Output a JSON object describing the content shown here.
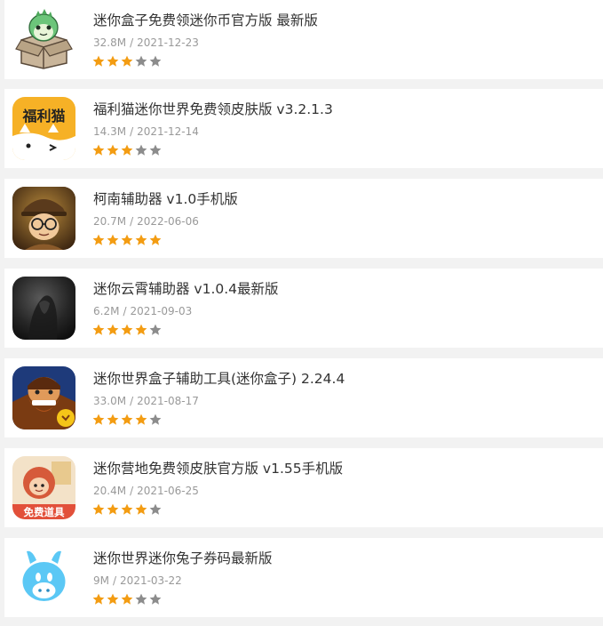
{
  "colors": {
    "page_background": "#f2f2f2",
    "card_background": "#ffffff",
    "title_text": "#333333",
    "meta_text": "#999999",
    "star_filled": "#f39c12",
    "star_empty": "#8c8c8c"
  },
  "apps": [
    {
      "title": "迷你盒子免费领迷你币官方版 最新版",
      "size": "32.8M",
      "date": "2021-12-23",
      "rating": 3,
      "max_rating": 5,
      "icon": "green-dinosaur-in-box-icon"
    },
    {
      "title": "福利猫迷你世界免费领皮肤版 v3.2.1.3",
      "size": "14.3M",
      "date": "2021-12-14",
      "rating": 3,
      "max_rating": 5,
      "icon": "fulimao-cat-icon",
      "icon_text": "福利猫"
    },
    {
      "title": "柯南辅助器 v1.0手机版",
      "size": "20.7M",
      "date": "2022-06-06",
      "rating": 5,
      "max_rating": 5,
      "icon": "detective-character-icon"
    },
    {
      "title": "迷你云霄辅助器 v1.0.4最新版",
      "size": "6.2M",
      "date": "2021-09-03",
      "rating": 4,
      "max_rating": 5,
      "icon": "dark-figure-icon"
    },
    {
      "title": "迷你世界盒子辅助工具(迷你盒子) 2.24.4",
      "size": "33.0M",
      "date": "2021-08-17",
      "rating": 4,
      "max_rating": 5,
      "icon": "bearded-warrior-icon"
    },
    {
      "title": "迷你营地免费领皮肤官方版 v1.55手机版",
      "size": "20.4M",
      "date": "2021-06-25",
      "rating": 4,
      "max_rating": 5,
      "icon": "free-items-girl-icon",
      "icon_text": "免费道具"
    },
    {
      "title": "迷你世界迷你兔子券码最新版",
      "size": "9M",
      "date": "2021-03-22",
      "rating": 3,
      "max_rating": 5,
      "icon": "blue-rabbit-icon"
    }
  ],
  "meta_separator": "/"
}
